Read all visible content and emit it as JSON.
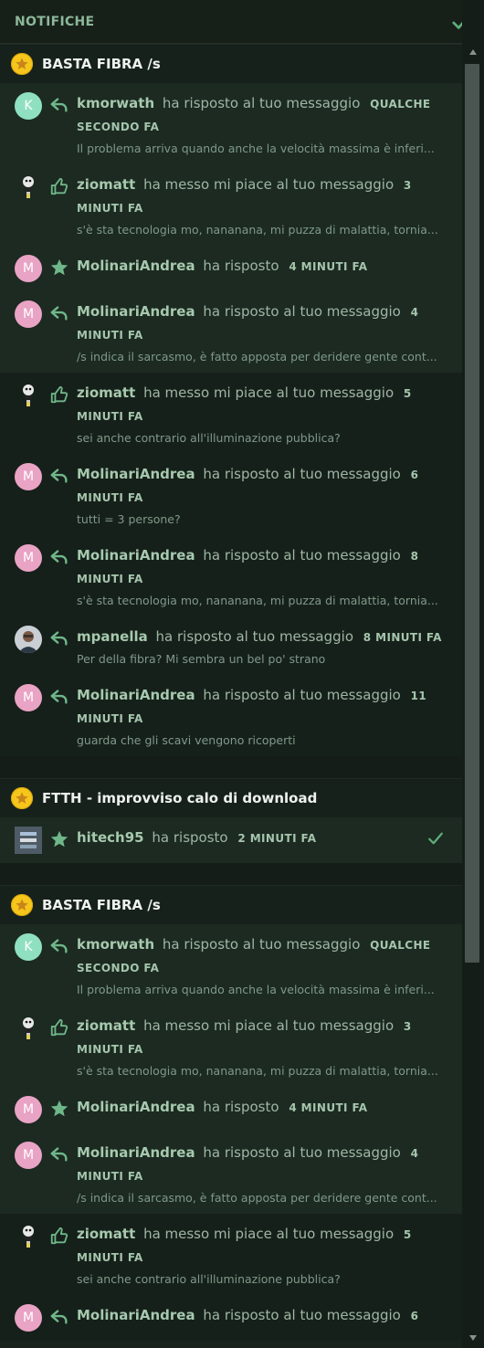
{
  "header": {
    "title": "NOTIFICHE"
  },
  "groups": [
    {
      "title": "BASTA FIBRA /s",
      "items": [
        {
          "avatar": "K",
          "avatar_type": "k",
          "action": "reply",
          "user": "kmorwath",
          "text": "ha risposto al tuo messaggio",
          "time": "QUALCHE SECONDO FA",
          "excerpt": "Il problema arriva quando anche la velocità massima è inferi...",
          "shade": "light"
        },
        {
          "avatar": "",
          "avatar_type": "z",
          "action": "like",
          "user": "ziomatt",
          "text": "ha messo mi piace al tuo messaggio",
          "time": "3 MINUTI FA",
          "excerpt": "s'è sta tecnologia mo, nananana, mi puzza di malattia, tornia...",
          "shade": "light"
        },
        {
          "avatar": "M",
          "avatar_type": "m",
          "action": "star",
          "user": "MolinariAndrea",
          "text": "ha risposto",
          "time": "4 MINUTI FA",
          "excerpt": "",
          "shade": "light"
        },
        {
          "avatar": "M",
          "avatar_type": "m",
          "action": "reply",
          "user": "MolinariAndrea",
          "text": "ha risposto al tuo messaggio",
          "time": "4 MINUTI FA",
          "excerpt": "/s indica il sarcasmo, è fatto apposta per deridere gente cont...",
          "shade": "light"
        },
        {
          "avatar": "",
          "avatar_type": "z",
          "action": "like",
          "user": "ziomatt",
          "text": "ha messo mi piace al tuo messaggio",
          "time": "5 MINUTI FA",
          "excerpt": "sei anche contrario all'illuminazione pubblica?",
          "shade": "dark"
        },
        {
          "avatar": "M",
          "avatar_type": "m",
          "action": "reply",
          "user": "MolinariAndrea",
          "text": "ha risposto al tuo messaggio",
          "time": "6 MINUTI FA",
          "excerpt": "tutti = 3 persone?",
          "shade": "dark"
        },
        {
          "avatar": "M",
          "avatar_type": "m",
          "action": "reply",
          "user": "MolinariAndrea",
          "text": "ha risposto al tuo messaggio",
          "time": "8 MINUTI FA",
          "excerpt": "s'è sta tecnologia mo, nananana, mi puzza di malattia, tornia...",
          "shade": "dark"
        },
        {
          "avatar": "",
          "avatar_type": "photo",
          "action": "reply",
          "user": "mpanella",
          "text": "ha risposto al tuo messaggio",
          "time": "8 MINUTI FA",
          "excerpt": "Per della fibra? Mi sembra un bel po' strano",
          "shade": "dark"
        },
        {
          "avatar": "M",
          "avatar_type": "m",
          "action": "reply",
          "user": "MolinariAndrea",
          "text": "ha risposto al tuo messaggio",
          "time": "11 MINUTI FA",
          "excerpt": "guarda che gli scavi vengono ricoperti",
          "shade": "dark"
        }
      ]
    },
    {
      "title": "FTTH - improvviso calo di download",
      "items": [
        {
          "avatar": "",
          "avatar_type": "tech",
          "action": "star",
          "user": "hitech95",
          "text": "ha risposto",
          "time": "2 MINUTI FA",
          "excerpt": "",
          "shade": "light",
          "done": true
        }
      ]
    },
    {
      "title": "BASTA FIBRA /s",
      "items": [
        {
          "avatar": "K",
          "avatar_type": "k",
          "action": "reply",
          "user": "kmorwath",
          "text": "ha risposto al tuo messaggio",
          "time": "QUALCHE SECONDO FA",
          "excerpt": "Il problema arriva quando anche la velocità massima è inferi...",
          "shade": "light"
        },
        {
          "avatar": "",
          "avatar_type": "z",
          "action": "like",
          "user": "ziomatt",
          "text": "ha messo mi piace al tuo messaggio",
          "time": "3 MINUTI FA",
          "excerpt": "s'è sta tecnologia mo, nananana, mi puzza di malattia, tornia...",
          "shade": "light"
        },
        {
          "avatar": "M",
          "avatar_type": "m",
          "action": "star",
          "user": "MolinariAndrea",
          "text": "ha risposto",
          "time": "4 MINUTI FA",
          "excerpt": "",
          "shade": "light"
        },
        {
          "avatar": "M",
          "avatar_type": "m",
          "action": "reply",
          "user": "MolinariAndrea",
          "text": "ha risposto al tuo messaggio",
          "time": "4 MINUTI FA",
          "excerpt": "/s indica il sarcasmo, è fatto apposta per deridere gente cont...",
          "shade": "light"
        },
        {
          "avatar": "",
          "avatar_type": "z",
          "action": "like",
          "user": "ziomatt",
          "text": "ha messo mi piace al tuo messaggio",
          "time": "5 MINUTI FA",
          "excerpt": "sei anche contrario all'illuminazione pubblica?",
          "shade": "dark"
        },
        {
          "avatar": "M",
          "avatar_type": "m",
          "action": "reply",
          "user": "MolinariAndrea",
          "text": "ha risposto al tuo messaggio",
          "time": "6",
          "excerpt": "",
          "shade": "dark"
        }
      ]
    }
  ],
  "colors": {
    "accent": "#5fae7a",
    "badge": "#f6c61c"
  }
}
